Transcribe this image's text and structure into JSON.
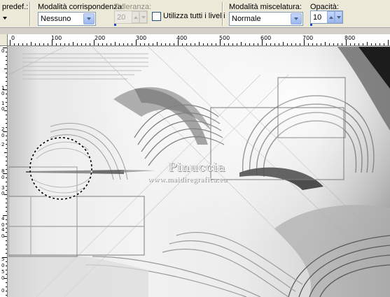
{
  "toolbar": {
    "preset_label": "predef.:",
    "match_mode": {
      "label": "Modalità corrispondenza:",
      "value": "Nessuno"
    },
    "tolerance": {
      "label": "Tolleranza:",
      "value": "20"
    },
    "use_all_layers": {
      "label": "Utilizza tutti i livelli",
      "checked": false
    },
    "blend_mode": {
      "label": "Modalità miscelatura:",
      "value": "Normale"
    },
    "opacity": {
      "label": "Opacità:",
      "value": "10"
    }
  },
  "ruler_top": {
    "labels": [
      "0",
      "100",
      "200",
      "300",
      "400",
      "500",
      "600",
      "700",
      "800"
    ]
  },
  "ruler_left": {
    "labels": [
      "0",
      "1",
      "0",
      "1",
      "0",
      "2",
      "0",
      "2",
      "8",
      "0",
      "3",
      "0",
      "4",
      "0",
      "4",
      "0",
      "5",
      "0",
      "5",
      "0",
      "0"
    ]
  },
  "canvas": {
    "watermark_title": "Pinuccia",
    "watermark_url": "www.maidiregrafica.eu"
  },
  "colors": {
    "accent": "#1846c4",
    "toolbar_bg": "#ece9d8",
    "combo_border": "#7f9db9"
  }
}
